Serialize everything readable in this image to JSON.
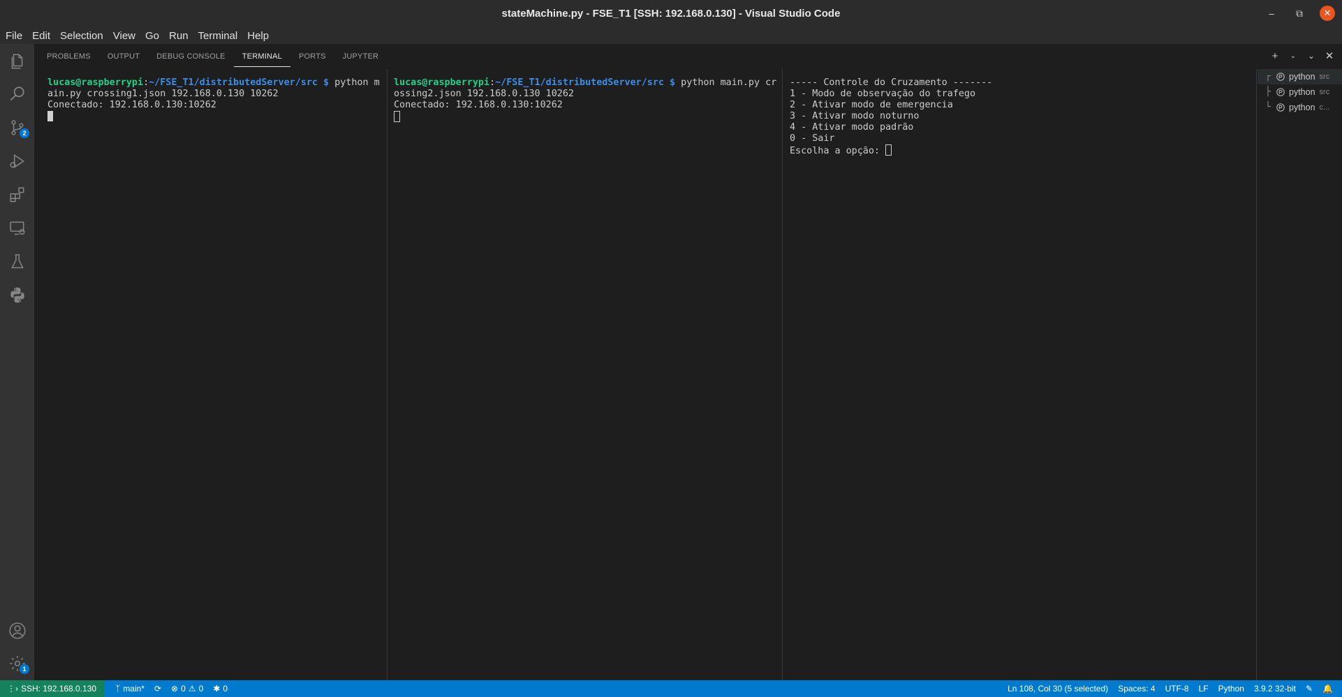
{
  "window": {
    "title": "stateMachine.py - FSE_T1 [SSH: 192.168.0.130] - Visual Studio Code",
    "controls": [
      "minimize-icon",
      "restore-icon",
      "close-icon"
    ]
  },
  "menu": [
    "File",
    "Edit",
    "Selection",
    "View",
    "Go",
    "Run",
    "Terminal",
    "Help"
  ],
  "activity_bar": {
    "items": [
      "explorer-icon",
      "search-icon",
      "source-control-icon",
      "run-debug-icon",
      "extensions-icon",
      "remote-explorer-icon",
      "testing-icon",
      "python-icon"
    ],
    "source_control_badge": "2",
    "bottom": [
      "accounts-icon",
      "manage-icon"
    ],
    "manage_badge": "1"
  },
  "panel": {
    "tabs": [
      {
        "label": "PROBLEMS",
        "active": false
      },
      {
        "label": "OUTPUT",
        "active": false
      },
      {
        "label": "DEBUG CONSOLE",
        "active": false
      },
      {
        "label": "TERMINAL",
        "active": true
      },
      {
        "label": "PORTS",
        "active": false
      },
      {
        "label": "JUPYTER",
        "active": false
      }
    ],
    "actions": [
      "new-terminal-icon",
      "launch-profile-icon",
      "maximize-panel-icon",
      "close-panel-icon"
    ]
  },
  "terminals": {
    "pane1": {
      "prompt_user": "lucas@raspberrypi",
      "prompt_colon": ":",
      "prompt_path": "~/FSE_T1/distributedServer/src",
      "prompt_dollar": " $ ",
      "cmd_line1": "python m",
      "line2": "ain.py crossing1.json 192.168.0.130 10262",
      "line3": "Conectado: 192.168.0.130:10262"
    },
    "pane2": {
      "prompt_user": "lucas@raspberrypi",
      "prompt_colon": ":",
      "prompt_path": "~/FSE_T1/distributedServer/src",
      "prompt_dollar": " $ ",
      "cmd_line1": "python main.py cr",
      "line2": "ossing2.json 192.168.0.130 10262",
      "line3": "Conectado: 192.168.0.130:10262"
    },
    "pane3": {
      "lines": [
        "----- Controle do Cruzamento -------",
        "1 - Modo de observação do trafego",
        "2 - Ativar modo de emergencia",
        "3 - Ativar modo noturno",
        "4 - Ativar modo padrão",
        "0 - Sair"
      ],
      "prompt": "Escolha a opção: "
    },
    "list": [
      {
        "name": "python",
        "desc": "src"
      },
      {
        "name": "python",
        "desc": "src"
      },
      {
        "name": "python",
        "desc": "c..."
      }
    ]
  },
  "status": {
    "remote": "SSH: 192.168.0.130",
    "branch": "main*",
    "errors": "0",
    "warnings": "0",
    "ports": "0",
    "position": "Ln 108, Col 30 (5 selected)",
    "spaces": "Spaces: 4",
    "encoding": "UTF-8",
    "eol": "LF",
    "language": "Python",
    "interpreter": "3.9.2 32-bit"
  },
  "colors": {
    "statusbar": "#007acc",
    "remote": "#16825d",
    "prompt_user": "#23d18b",
    "prompt_path": "#3b8eea"
  }
}
